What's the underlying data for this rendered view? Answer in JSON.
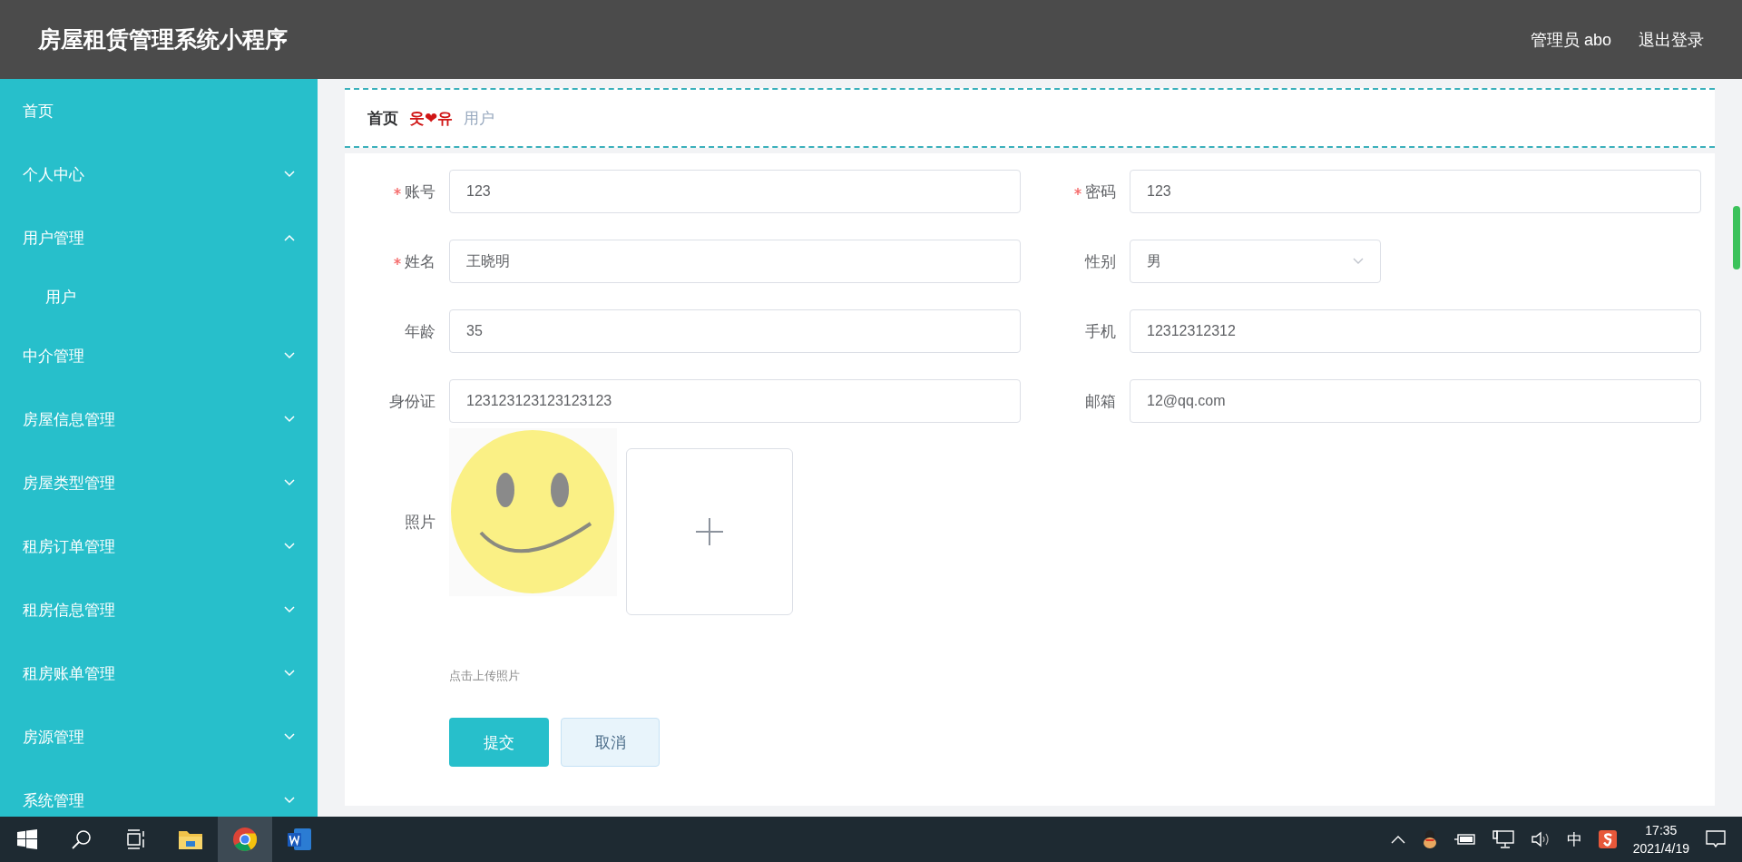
{
  "header": {
    "title": "房屋租赁管理系统小程序",
    "user": "管理员 abo",
    "logout": "退出登录"
  },
  "sidebar": {
    "items": [
      {
        "label": "首页"
      },
      {
        "label": "个人中心",
        "expanded": false
      },
      {
        "label": "用户管理",
        "expanded": true,
        "children": [
          {
            "label": "用户"
          }
        ]
      },
      {
        "label": "中介管理",
        "expanded": false
      },
      {
        "label": "房屋信息管理",
        "expanded": false
      },
      {
        "label": "房屋类型管理",
        "expanded": false
      },
      {
        "label": "租房订单管理",
        "expanded": false
      },
      {
        "label": "租房信息管理",
        "expanded": false
      },
      {
        "label": "租房账单管理",
        "expanded": false
      },
      {
        "label": "房源管理",
        "expanded": false
      },
      {
        "label": "系统管理",
        "expanded": false
      }
    ]
  },
  "breadcrumb": {
    "home": "首页",
    "separator": "웃❤유",
    "current": "用户"
  },
  "form": {
    "fields": [
      {
        "label": "账号",
        "required": true,
        "value": "123",
        "kind": "text"
      },
      {
        "label": "密码",
        "required": true,
        "value": "123",
        "kind": "text"
      },
      {
        "label": "姓名",
        "required": true,
        "value": "王晓明",
        "kind": "text"
      },
      {
        "label": "性别",
        "required": false,
        "value": "男",
        "kind": "select"
      },
      {
        "label": "年龄",
        "required": false,
        "value": "35",
        "kind": "text"
      },
      {
        "label": "手机",
        "required": false,
        "value": "12312312312",
        "kind": "text"
      },
      {
        "label": "身份证",
        "required": false,
        "value": "123123123123123123",
        "kind": "text"
      },
      {
        "label": "邮箱",
        "required": false,
        "value": "12@qq.com",
        "kind": "text"
      }
    ],
    "photo": {
      "label": "照片",
      "hint": "点击上传照片"
    },
    "buttons": [
      {
        "label": "提交",
        "kind": "primary"
      },
      {
        "label": "取消",
        "kind": "default"
      }
    ]
  },
  "taskbar": {
    "apps": [
      {
        "kind": "folder",
        "selected": false
      },
      {
        "kind": "browser",
        "selected": true
      },
      {
        "kind": "word",
        "selected": false
      }
    ],
    "ime": "中",
    "time": "17:35",
    "date": "2021/4/19"
  }
}
